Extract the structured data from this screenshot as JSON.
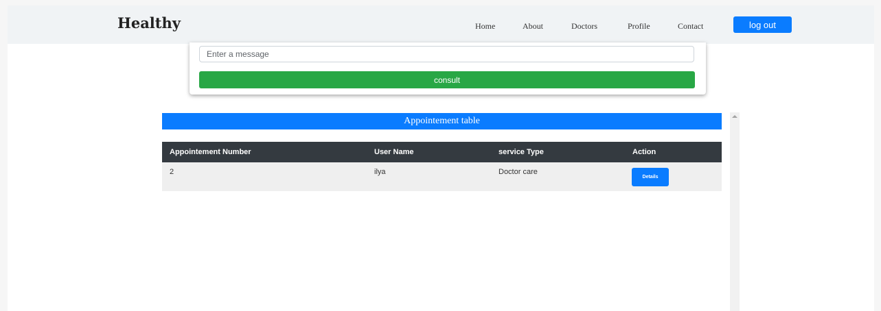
{
  "navbar": {
    "brand": "Healthy",
    "links": [
      "Home",
      "About",
      "Doctors",
      "Profile",
      "Contact"
    ],
    "logout_label": "log out"
  },
  "consult_form": {
    "message_placeholder": "Enter a message",
    "message_value": "",
    "consult_label": "consult"
  },
  "appointment_table": {
    "title": "Appointement table",
    "columns": [
      "Appointement Number",
      "User Name",
      "service Type",
      "Action"
    ],
    "rows": [
      {
        "number": "2",
        "user_name": "ilya",
        "service_type": "Doctor care",
        "action_label": "Details"
      }
    ]
  },
  "colors": {
    "primary": "#0a7cff",
    "success": "#28a745",
    "dark_header": "#343a40",
    "navbar_bg": "#f0f3f5"
  }
}
